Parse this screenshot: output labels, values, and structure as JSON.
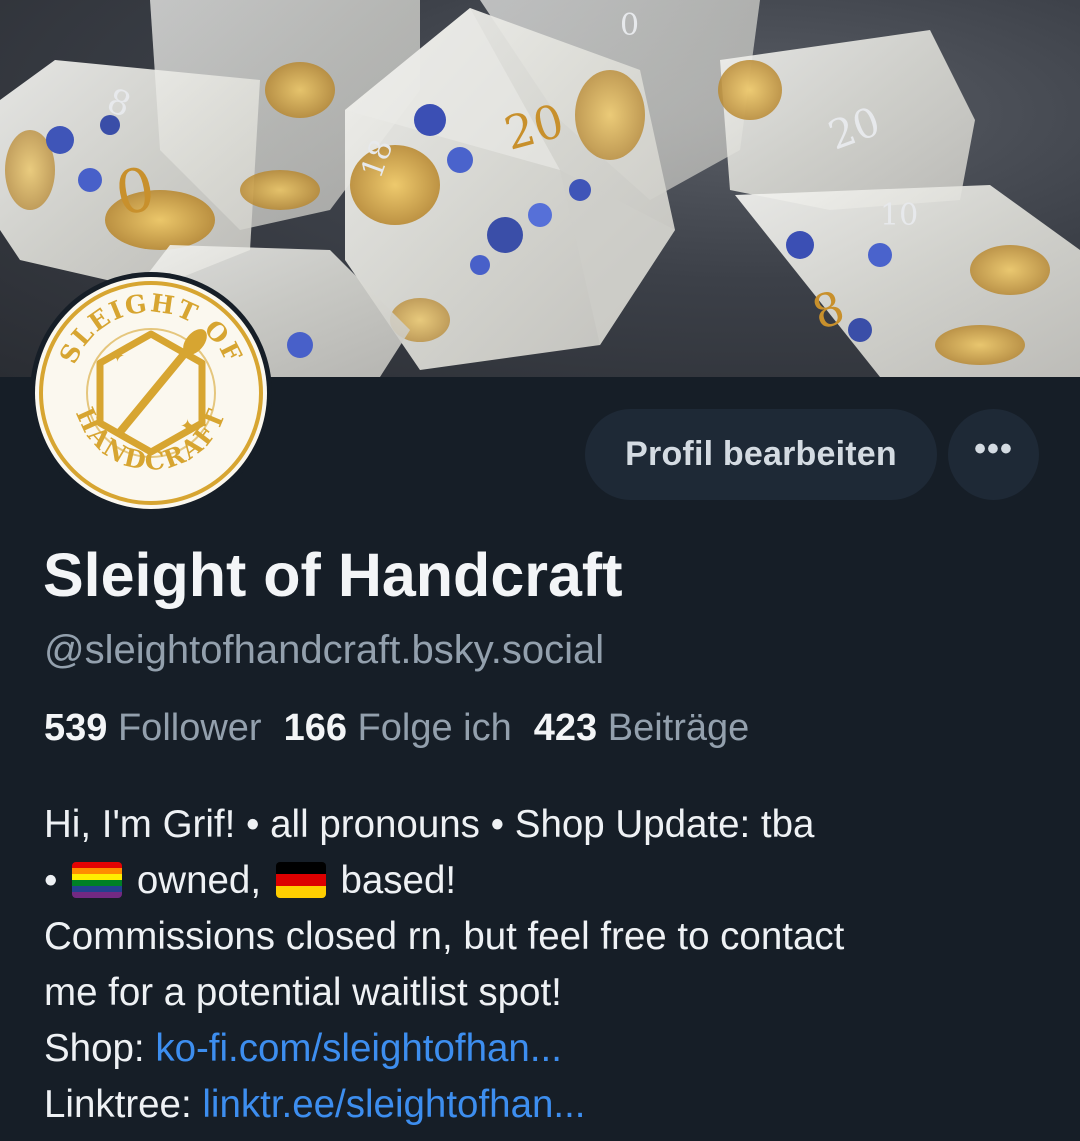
{
  "profile": {
    "display_name": "Sleight of Handcraft",
    "handle": "@sleightofhandcraft.bsky.social",
    "avatar": {
      "logo_text_top": "SLEIGHT OF",
      "logo_text_bottom": "HANDCRAFT",
      "icon": "paintbrush-hexagon-logo"
    },
    "banner": {
      "icon": "resin-dice-photo"
    }
  },
  "actions": {
    "edit_label": "Profil bearbeiten",
    "more_label": "•••",
    "more_icon": "ellipsis-icon"
  },
  "stats": {
    "followers_count": "539",
    "followers_label": "Follower",
    "following_count": "166",
    "following_label": "Folge ich",
    "posts_count": "423",
    "posts_label": "Beiträge"
  },
  "bio": {
    "line1": "Hi, I'm Grif! • all pronouns • Shop Update: tba",
    "line2_prefix": "•",
    "line2_flag1": "rainbow-flag",
    "line2_mid": "owned,",
    "line2_flag2": "germany-flag",
    "line2_suffix": "based!",
    "line3": "Commissions closed rn, but feel free to contact",
    "line4": "me for a potential waitlist spot!",
    "shop_label": "Shop:",
    "shop_link": "ko-fi.com/sleightofhan...",
    "linktree_label": "Linktree:",
    "linktree_link": "linktr.ee/sleightofhan..."
  },
  "colors": {
    "background": "#161e27",
    "button_bg": "#1e2936",
    "muted_text": "#93a0ad",
    "link": "#3d8eef",
    "logo_gold": "#d7a531"
  }
}
